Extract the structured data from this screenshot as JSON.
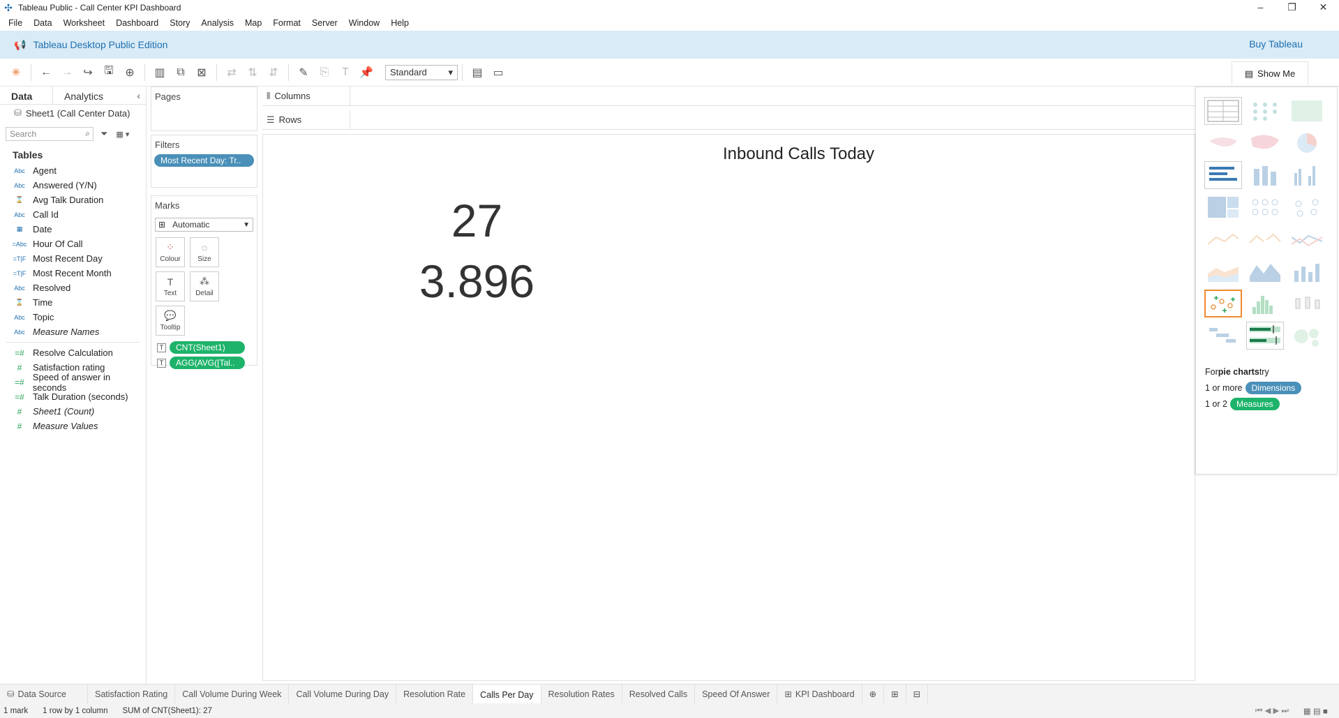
{
  "window": {
    "title": "Tableau Public - Call Center KPI Dashboard"
  },
  "menu": [
    "File",
    "Data",
    "Worksheet",
    "Dashboard",
    "Story",
    "Analysis",
    "Map",
    "Format",
    "Server",
    "Window",
    "Help"
  ],
  "banner": {
    "edition": "Tableau Desktop Public Edition",
    "buy": "Buy Tableau"
  },
  "toolbar": {
    "fit": "Standard",
    "show_me": "Show Me"
  },
  "data_pane": {
    "tab_data": "Data",
    "tab_analytics": "Analytics",
    "datasource": "Sheet1 (Call Center Data)",
    "search_placeholder": "Search",
    "tables_title": "Tables",
    "fields": [
      {
        "icon": "Abc",
        "name": "Agent"
      },
      {
        "icon": "Abc",
        "name": "Answered (Y/N)"
      },
      {
        "icon": "⌛",
        "name": "Avg Talk Duration"
      },
      {
        "icon": "Abc",
        "name": "Call Id"
      },
      {
        "icon": "▦",
        "name": "Date"
      },
      {
        "icon": "=Abc",
        "name": "Hour Of Call"
      },
      {
        "icon": "=T|F",
        "name": "Most Recent Day"
      },
      {
        "icon": "=T|F",
        "name": "Most Recent Month"
      },
      {
        "icon": "Abc",
        "name": "Resolved"
      },
      {
        "icon": "⌛",
        "name": "Time"
      },
      {
        "icon": "Abc",
        "name": "Topic"
      },
      {
        "icon": "Abc",
        "name": "Measure Names"
      }
    ],
    "measures": [
      {
        "icon": "=#",
        "name": "Resolve Calculation"
      },
      {
        "icon": "#",
        "name": "Satisfaction rating"
      },
      {
        "icon": "=#",
        "name": "Speed of answer in seconds"
      },
      {
        "icon": "=#",
        "name": "Talk Duration (seconds)"
      },
      {
        "icon": "#",
        "name": "Sheet1 (Count)"
      },
      {
        "icon": "#",
        "name": "Measure Values"
      }
    ]
  },
  "pages": {
    "title": "Pages"
  },
  "filters": {
    "title": "Filters",
    "pill": "Most Recent Day: Tr.."
  },
  "marks": {
    "title": "Marks",
    "type": "Automatic",
    "cards": [
      "Colour",
      "Size",
      "Text",
      "Detail",
      "Tooltip"
    ],
    "pills": [
      "CNT(Sheet1)",
      "AGG(AVG([Tal.."
    ]
  },
  "shelves": {
    "columns": "Columns",
    "rows": "Rows"
  },
  "view": {
    "title": "Inbound Calls Today",
    "kpi_count": "27",
    "kpi_avg": "3.896"
  },
  "show_me": {
    "prefix": "For ",
    "chart_type": "pie charts",
    "suffix": " try",
    "dim_prefix": "1 or more",
    "dim_pill": "Dimensions",
    "meas_prefix": "1 or 2",
    "meas_pill": "Measures"
  },
  "sheet_tabs": [
    "Satisfaction Rating",
    "Call Volume During Week",
    "Call Volume During Day",
    "Resolution Rate",
    "Calls Per Day",
    "Resolution Rates",
    "Resolved Calls",
    "Speed Of Answer",
    "KPI Dashboard"
  ],
  "data_source_tab": "Data Source",
  "status": {
    "marks": "1 mark",
    "dims": "1 row by  1 column",
    "sum": "SUM of CNT(Sheet1): 27"
  }
}
